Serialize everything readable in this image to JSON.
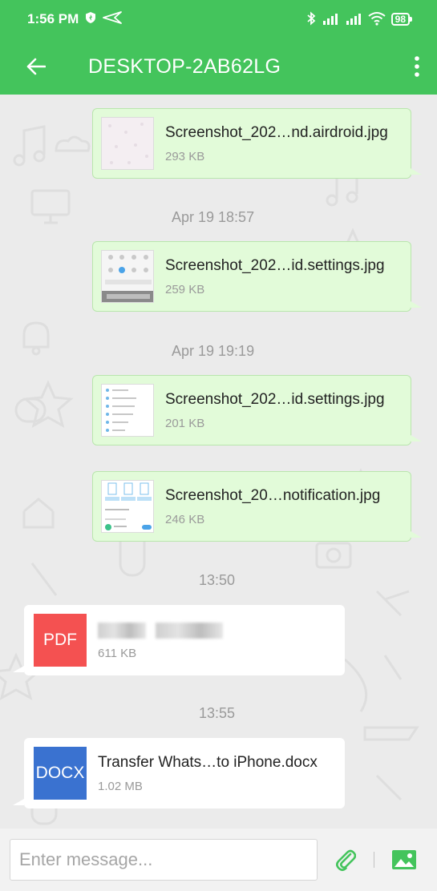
{
  "status_bar": {
    "time": "1:56 PM",
    "battery": "98"
  },
  "header": {
    "title": "DESKTOP-2AB62LG"
  },
  "messages": [
    {
      "name": "Screenshot_202…nd.airdroid.jpg",
      "size": "293 KB"
    },
    {
      "name": "Screenshot_202…id.settings.jpg",
      "size": "259 KB"
    },
    {
      "name": "Screenshot_202…id.settings.jpg",
      "size": "201 KB"
    },
    {
      "name": "Screenshot_20…notification.jpg",
      "size": "246 KB"
    },
    {
      "name": "",
      "size": "611 KB",
      "badge": "PDF"
    },
    {
      "name": "Transfer Whats…to iPhone.docx",
      "size": "1.02 MB",
      "badge": "DOCX"
    }
  ],
  "timestamps": [
    "Apr 19  18:57",
    "Apr 19  19:19",
    "13:50",
    "13:55"
  ],
  "input": {
    "placeholder": "Enter message..."
  },
  "colors": {
    "brand": "#44c45c",
    "pdf": "#f45151",
    "docx": "#3a72d0",
    "sent_bubble": "#e2fbd9"
  }
}
